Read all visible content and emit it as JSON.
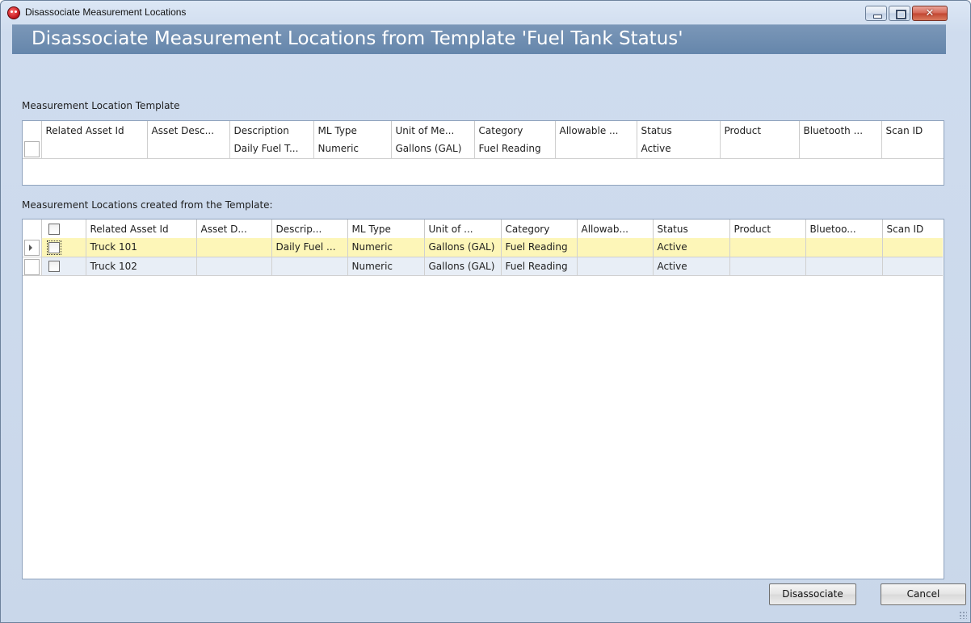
{
  "window": {
    "title": "Disassociate Measurement Locations",
    "close_glyph": "✕"
  },
  "header": {
    "title": "Disassociate Measurement Locations from Template 'Fuel Tank Status'"
  },
  "template_section": {
    "label": "Measurement Location Template",
    "columns": [
      "Related Asset Id",
      "Asset Desc...",
      "Description",
      "ML Type",
      "Unit of Me...",
      "Category",
      "Allowable ...",
      "Status",
      "Product",
      "Bluetooth ...",
      "Scan ID"
    ],
    "rows": [
      [
        "",
        "",
        "Daily Fuel T...",
        "Numeric",
        "Gallons (GAL)",
        "Fuel Reading",
        "",
        "Active",
        "",
        "",
        ""
      ]
    ]
  },
  "locations_section": {
    "label": "Measurement Locations created from the Template:",
    "columns": [
      "Related Asset Id",
      "Asset D...",
      "Descrip...",
      "ML Type",
      "Unit of ...",
      "Category",
      "Allowab...",
      "Status",
      "Product",
      "Bluetoo...",
      "Scan ID"
    ],
    "rows": [
      [
        "Truck 101",
        "",
        "Daily Fuel ...",
        "Numeric",
        "Gallons (GAL)",
        "Fuel Reading",
        "",
        "Active",
        "",
        "",
        ""
      ],
      [
        "Truck 102",
        "",
        "",
        "Numeric",
        "Gallons (GAL)",
        "Fuel Reading",
        "",
        "Active",
        "",
        "",
        ""
      ]
    ]
  },
  "buttons": {
    "disassociate": "Disassociate",
    "cancel": "Cancel"
  },
  "colors": {
    "banner": "#6f8db1",
    "selected_row": "#fdf6b8",
    "alt_row": "#e8eef6"
  }
}
